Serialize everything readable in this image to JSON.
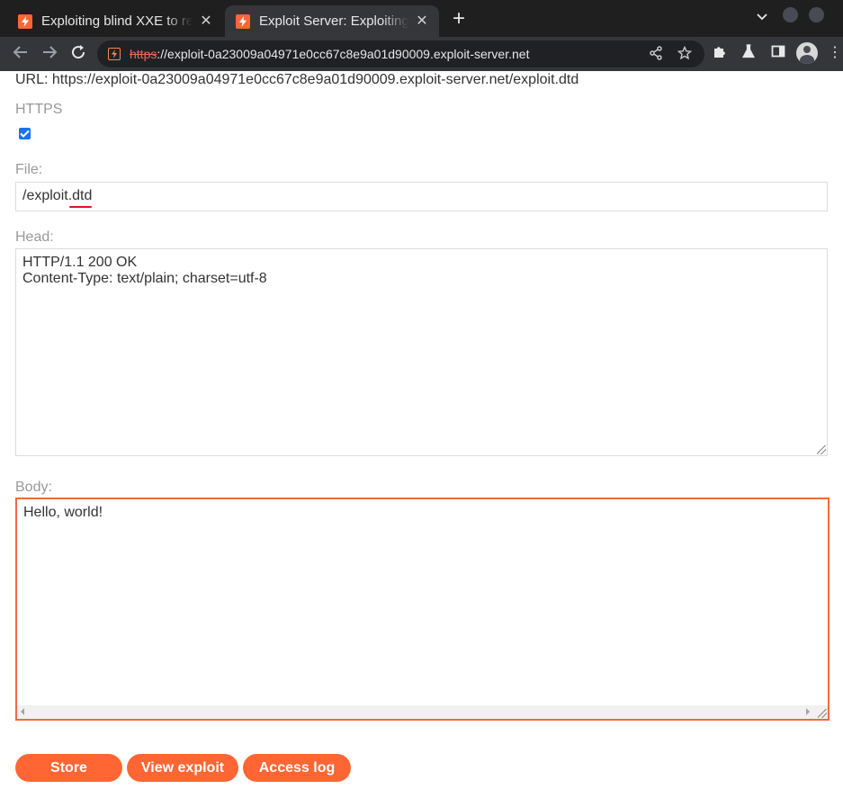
{
  "browser": {
    "tabs": [
      {
        "title": "Exploiting blind XXE to retrieve data via error messages",
        "active": false
      },
      {
        "title": "Exploit Server: Exploiting blind XXE to retrieve data via error messages",
        "active": true
      }
    ],
    "address_bar": {
      "scheme": "https",
      "rest": "://exploit-0a23009a04971e0cc67c8e9a01d90009.exploit-server.net"
    },
    "icons": {
      "favicon": "lightning-favicon-icon",
      "close": "close-icon",
      "new_tab": "plus-icon",
      "tab_menu": "chevron-down-icon",
      "back": "back-arrow-icon",
      "forward": "forward-arrow-icon",
      "reload": "reload-icon",
      "not_secure": "not-secure-icon",
      "share": "share-icon",
      "bookmark": "star-icon",
      "extensions": "puzzle-icon",
      "labs": "flask-icon",
      "side_panel": "side-panel-icon",
      "profile": "avatar-icon",
      "menu": "kebab-menu-icon"
    }
  },
  "form": {
    "url_line": "URL: https://exploit-0a23009a04971e0cc67c8e9a01d90009.exploit-server.net/exploit.dtd",
    "https_label": "HTTPS",
    "https_checked": true,
    "file_label": "File:",
    "file_value_prefix": "/exploit.",
    "file_value_misspelled": "dtd",
    "head_label": "Head:",
    "head_lines": [
      "HTTP/1.1 200 OK",
      "Content-Type: text/plain; charset=utf-8"
    ],
    "body_label": "Body:",
    "body_value": "Hello, world!"
  },
  "buttons": {
    "store": "Store",
    "view_exploit": "View exploit",
    "access_log": "Access log"
  },
  "colors": {
    "accent": "#ff6633",
    "focus_border": "#ee6a42",
    "label": "#999999",
    "text": "#333333"
  }
}
